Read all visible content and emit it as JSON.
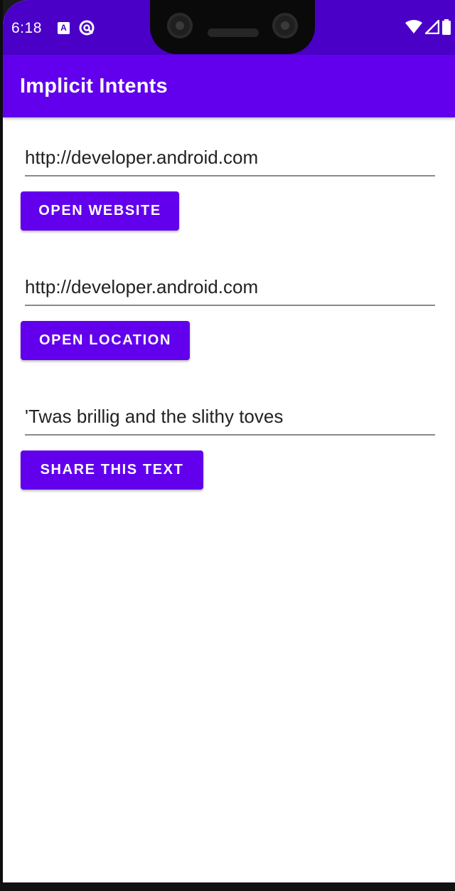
{
  "status_bar": {
    "time": "6:18",
    "notification_a": "A"
  },
  "app_bar": {
    "title": "Implicit Intents"
  },
  "website": {
    "field_value": "http://developer.android.com",
    "button_label": "OPEN WEBSITE"
  },
  "location": {
    "field_value": "http://developer.android.com",
    "button_label": "OPEN LOCATION"
  },
  "share": {
    "field_value": "'Twas brillig and the slithy toves",
    "button_label": "SHARE THIS TEXT"
  },
  "colors": {
    "primary": "#6200ee",
    "primary_dark": "#4a00c7",
    "on_primary": "#ffffff"
  },
  "icons": {
    "status": [
      "app-notification-icon",
      "sync-notification-icon",
      "wifi-icon",
      "cell-signal-icon",
      "battery-icon"
    ]
  }
}
